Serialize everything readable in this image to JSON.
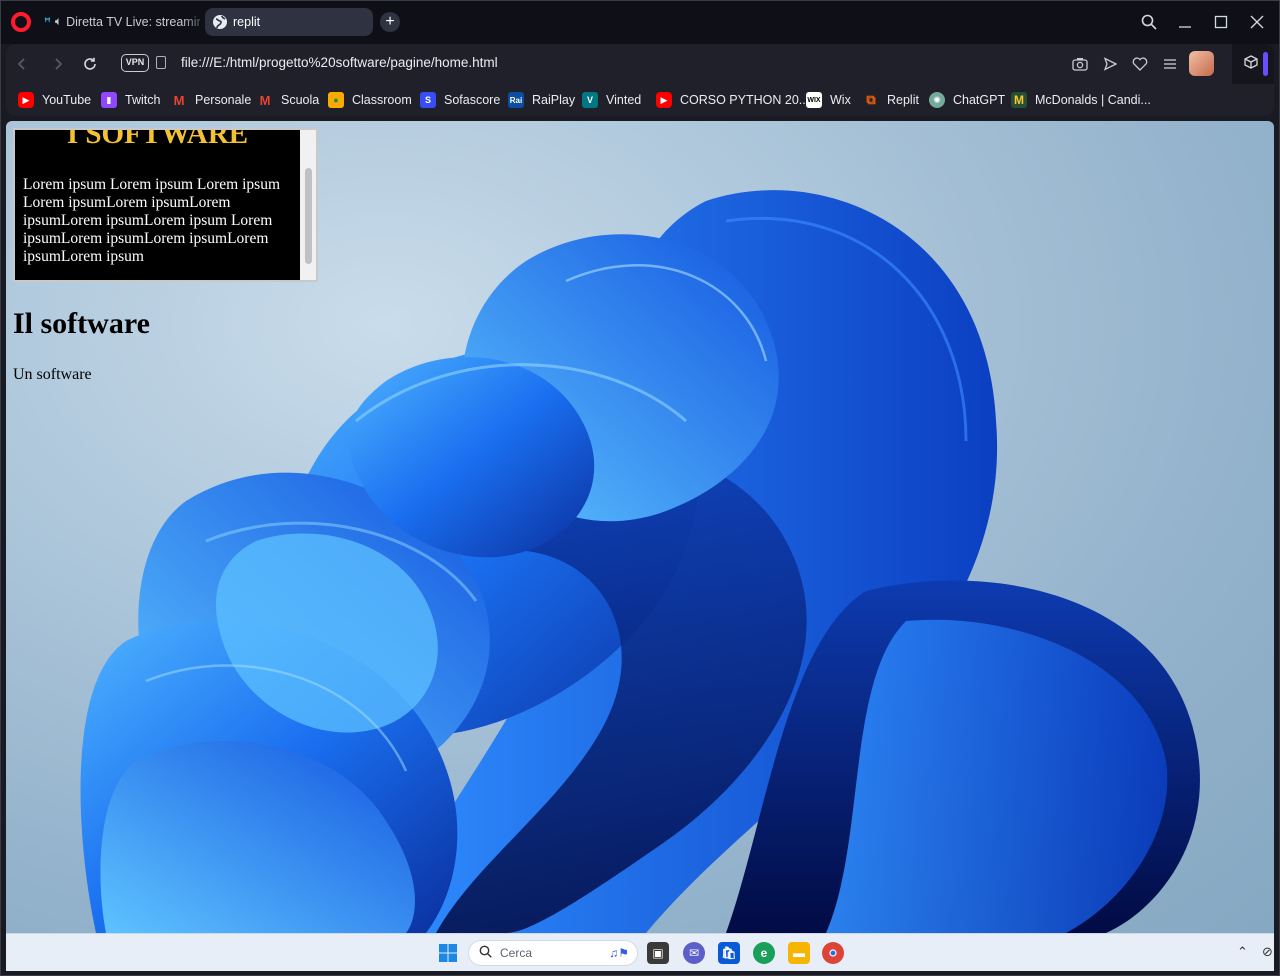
{
  "browser": {
    "tabs": [
      {
        "label": "Diretta TV Live: streaming",
        "icon": "tab-favicon-icon"
      },
      {
        "label": "replit",
        "icon": "globe-icon"
      }
    ],
    "address": {
      "vpn_label": "VPN",
      "url": "file:///E:/html/progetto%20software/pagine/home.html"
    }
  },
  "bookmarks": [
    {
      "label": "YouTube",
      "color": "#ff0000"
    },
    {
      "label": "Twitch",
      "color": "#9146ff"
    },
    {
      "label": "Personale",
      "color": "#ea4335"
    },
    {
      "label": "Scuola",
      "color": "#ea4335"
    },
    {
      "label": "Classroom",
      "color": "#f9ab00"
    },
    {
      "label": "Sofascore",
      "color": "#374df5"
    },
    {
      "label": "RaiPlay",
      "color": "#0b4ea2"
    },
    {
      "label": "Vinted",
      "color": "#007782"
    },
    {
      "label": "CORSO PYTHON 20...",
      "color": "#ff0000"
    },
    {
      "label": "Wix",
      "color": "#ffffff"
    },
    {
      "label": "Replit",
      "color": "#f26207"
    },
    {
      "label": "ChatGPT",
      "color": "#74aa9c"
    },
    {
      "label": "McDonalds | Candi...",
      "color": "#ffc72c"
    }
  ],
  "page": {
    "box_title": "I SOFTWARE",
    "box_text": "Lorem ipsum Lorem ipsum Lorem ipsum Lorem ipsumLorem ipsumLorem ipsumLorem ipsumLorem ipsum Lorem ipsumLorem ipsumLorem ipsumLorem ipsumLorem ipsum",
    "heading": "Il software",
    "paragraph": "Un software"
  },
  "taskbar": {
    "search_placeholder": "Cerca"
  },
  "colors": {
    "accent": "#6b4cff",
    "box_title": "#f2c233"
  }
}
